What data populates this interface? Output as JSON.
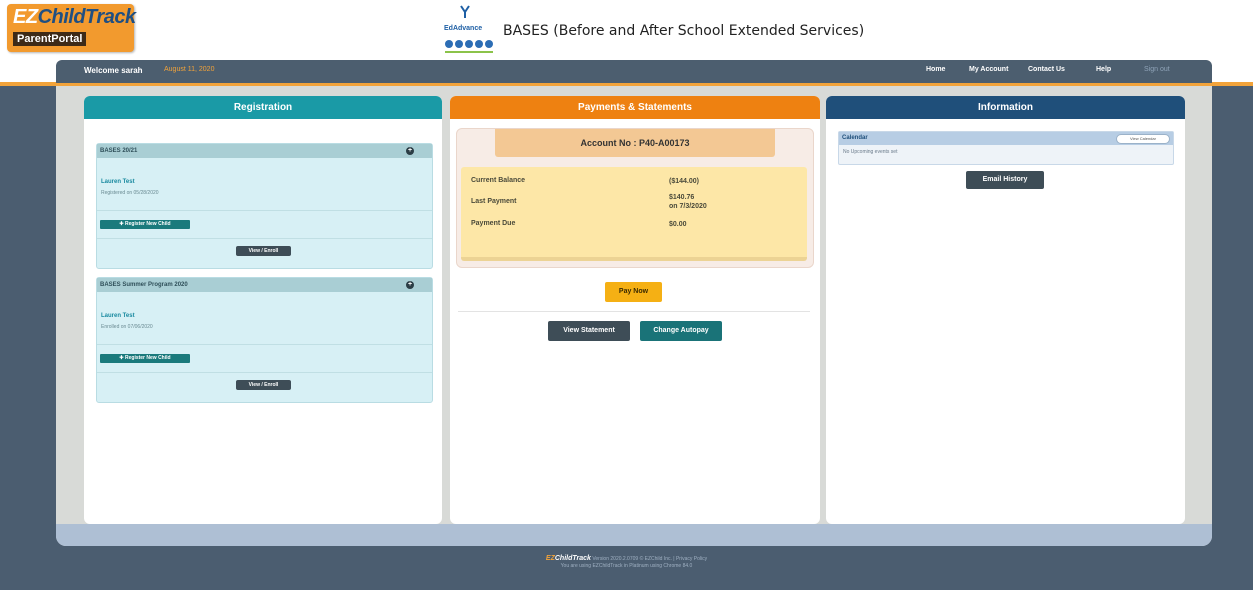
{
  "header": {
    "logo_ez": "EZ",
    "logo_childtrack": "ChildTrack",
    "logo_parent": "Parent",
    "logo_portal": "Portal",
    "edadvance_logo": "EdAdvance",
    "site_title": "BASES (Before and After School Extended Services)"
  },
  "nav": {
    "welcome": "Welcome sarah",
    "date": "August 11, 2020",
    "links": [
      "Home",
      "My Account",
      "Contact Us",
      "Help",
      "Sign out"
    ]
  },
  "registration": {
    "title": "Registration",
    "cards": [
      {
        "program": "BASES 20/21",
        "child": "Lauren Test",
        "status": "Registered on 05/28/2020",
        "register_label": "Register New Child",
        "view_label": "View / Enroll"
      },
      {
        "program": "BASES Summer Program 2020",
        "child": "Lauren Test",
        "status": "Enrolled on 07/06/2020",
        "register_label": "Register New Child",
        "view_label": "View / Enroll"
      }
    ]
  },
  "payments": {
    "title": "Payments & Statements",
    "account_no": "Account No : P40-A00173",
    "current_balance_label": "Current Balance",
    "current_balance": "($144.00)",
    "last_payment_label": "Last Payment",
    "last_payment_amount": "$140.76",
    "last_payment_date": "on 7/3/2020",
    "payment_due_label": "Payment Due",
    "payment_due": "$0.00",
    "pay_now": "Pay Now",
    "view_statement": "View Statement",
    "change_autopay": "Change Autopay"
  },
  "information": {
    "title": "Information",
    "calendar_label": "Calendar",
    "view_calendar": "View Calendar",
    "no_events": "No Upcoming events set",
    "email_history": "Email History"
  },
  "footer": {
    "brand_ez": "EZ",
    "brand_name": "ChildTrack",
    "line1_rest": "Version 2020.2.0709 © EZChild Inc. | Privacy Policy",
    "line2": "You are using EZChildTrack in Platinum using Chrome 84.0"
  },
  "colors": {
    "orange_accent": "#f2a33a",
    "registration_teal": "#1a9aa6",
    "payments_orange": "#ee8111",
    "information_navy": "#1f4f7a",
    "nav_slate": "#4c5e6f"
  }
}
